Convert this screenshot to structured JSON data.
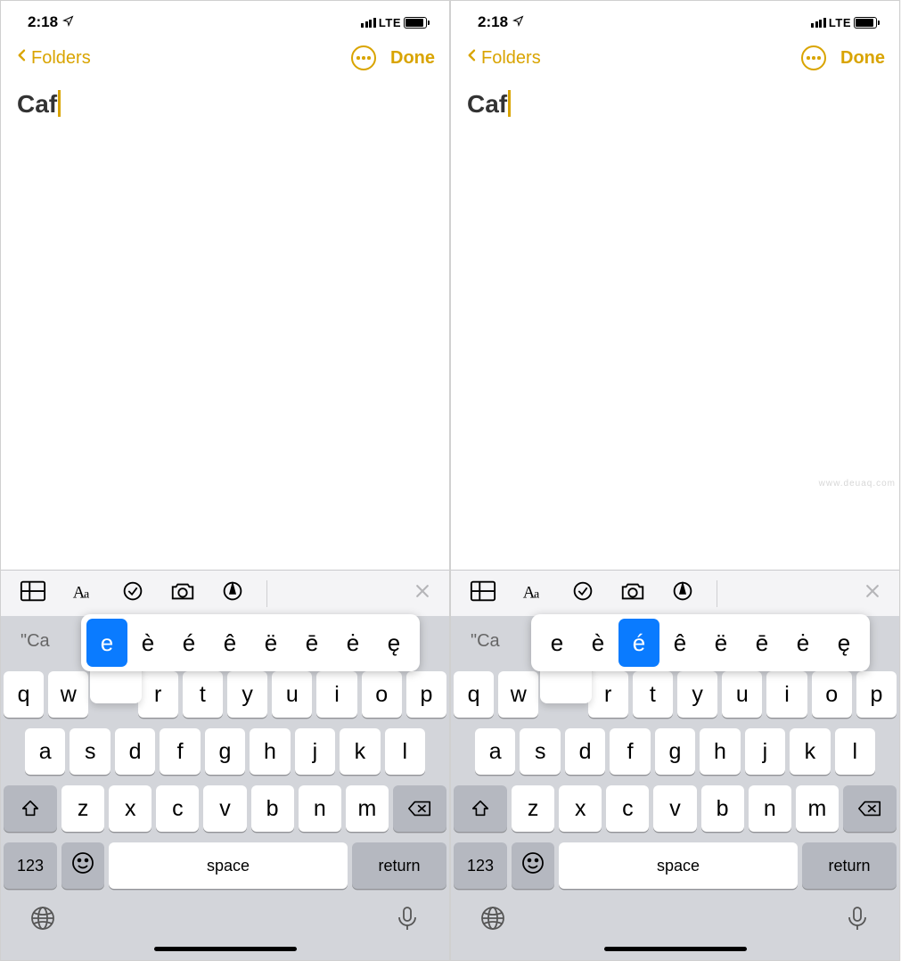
{
  "screens": [
    {
      "status": {
        "time": "2:18",
        "network": "LTE"
      },
      "nav": {
        "back_label": "Folders",
        "done_label": "Done"
      },
      "note": {
        "title": "Caf"
      },
      "toolbar_icons": [
        "table-icon",
        "format-icon",
        "checklist-icon",
        "camera-icon",
        "markup-icon"
      ],
      "suggestion_partial": "\"Ca",
      "accent_popup": {
        "options": [
          "e",
          "è",
          "é",
          "ê",
          "ë",
          "ē",
          "ė",
          "ę"
        ],
        "selected_index": 0
      },
      "keyboard": {
        "row1": [
          "q",
          "w",
          "e",
          "r",
          "t",
          "y",
          "u",
          "i",
          "o",
          "p"
        ],
        "row2": [
          "a",
          "s",
          "d",
          "f",
          "g",
          "h",
          "j",
          "k",
          "l"
        ],
        "row3": [
          "z",
          "x",
          "c",
          "v",
          "b",
          "n",
          "m"
        ],
        "numbers_label": "123",
        "space_label": "space",
        "return_label": "return"
      }
    },
    {
      "status": {
        "time": "2:18",
        "network": "LTE"
      },
      "nav": {
        "back_label": "Folders",
        "done_label": "Done"
      },
      "note": {
        "title": "Caf"
      },
      "toolbar_icons": [
        "table-icon",
        "format-icon",
        "checklist-icon",
        "camera-icon",
        "markup-icon"
      ],
      "suggestion_partial": "\"Ca",
      "accent_popup": {
        "options": [
          "e",
          "è",
          "é",
          "ê",
          "ë",
          "ē",
          "ė",
          "ę"
        ],
        "selected_index": 2
      },
      "keyboard": {
        "row1": [
          "q",
          "w",
          "e",
          "r",
          "t",
          "y",
          "u",
          "i",
          "o",
          "p"
        ],
        "row2": [
          "a",
          "s",
          "d",
          "f",
          "g",
          "h",
          "j",
          "k",
          "l"
        ],
        "row3": [
          "z",
          "x",
          "c",
          "v",
          "b",
          "n",
          "m"
        ],
        "numbers_label": "123",
        "space_label": "space",
        "return_label": "return"
      }
    }
  ],
  "watermark": "www.deuaq.com"
}
